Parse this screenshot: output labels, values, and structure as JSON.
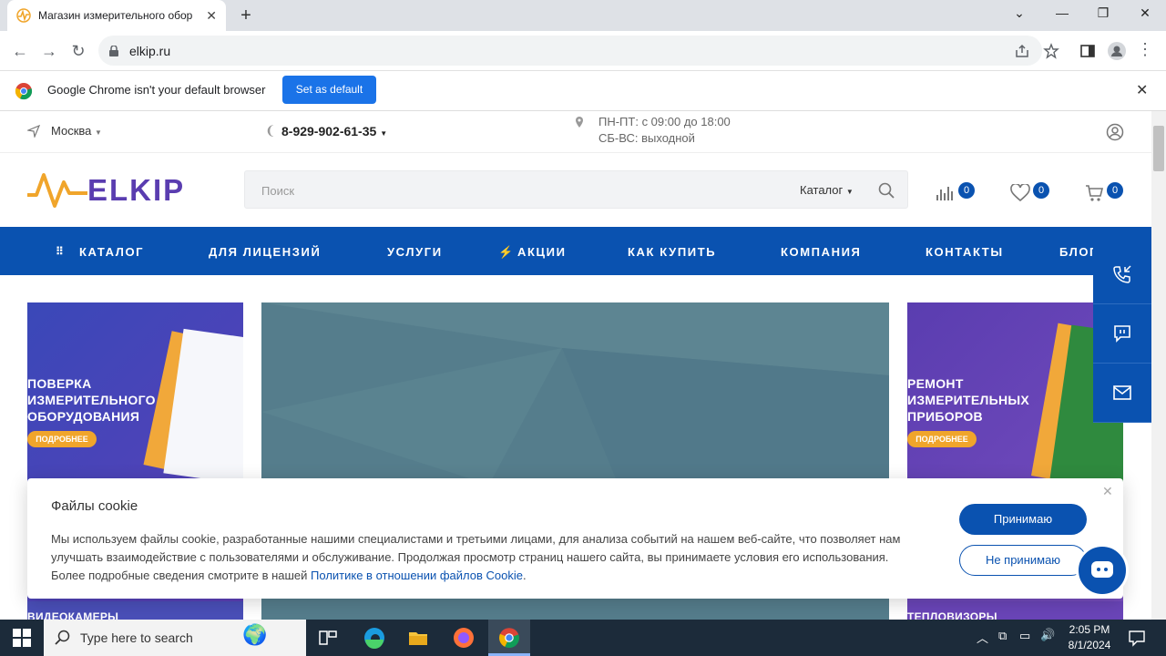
{
  "browser": {
    "tab_title": "Магазин измерительного обор",
    "url": "elkip.ru",
    "infobar_message": "Google Chrome isn't your default browser",
    "infobar_button": "Set as default"
  },
  "header": {
    "city": "Москва",
    "phone": "8-929-902-61-35",
    "hours_weekdays": "ПН-ПТ: с 09:00 до 18:00",
    "hours_weekend": "СБ-ВС: выходной",
    "logo_text": "ELKIP",
    "search_placeholder": "Поиск",
    "search_catalog": "Каталог",
    "compare_count": "0",
    "favorites_count": "0",
    "cart_count": "0"
  },
  "nav": {
    "items": [
      "КАТАЛОГ",
      "ДЛЯ ЛИЦЕНЗИЙ",
      "УСЛУГИ",
      "АКЦИИ",
      "КАК КУПИТЬ",
      "КОМПАНИЯ",
      "КОНТАКТЫ",
      "БЛОГ"
    ]
  },
  "banners": {
    "left_line1": "ПОВЕРКА",
    "left_line2": "ИЗМЕРИТЕЛЬНОГО",
    "left_line3": "ОБОРУДОВАНИЯ",
    "left_button": "ПОДРОБНЕЕ",
    "right_line1": "РЕМОНТ",
    "right_line2": "ИЗМЕРИТЕЛЬНЫХ",
    "right_line3": "ПРИБОРОВ",
    "right_button": "ПОДРОБНЕЕ",
    "bottom_left": "ВИДЕОКАМЕРЫ",
    "bottom_right": "ТЕПЛОВИЗОРЫ"
  },
  "cookie": {
    "title": "Файлы cookie",
    "text": "Мы используем файлы cookie, разработанные нашими специалистами и третьими лицами, для анализа событий на нашем веб-сайте, что позволяет нам улучшать взаимодействие с пользователями и обслуживание. Продолжая просмотр страниц нашего сайта, вы принимаете условия его использования. Более подробные сведения смотрите в нашей ",
    "link": "Политике в отношении файлов Cookie",
    "tail": ".",
    "accept": "Принимаю",
    "decline": "Не принимаю"
  },
  "taskbar": {
    "search_placeholder": "Type here to search",
    "time": "2:05 PM",
    "date": "8/1/2024"
  },
  "colors": {
    "brand_blue": "#0a52b0",
    "accent_orange": "#f0a52b",
    "banner_teal": "#557d8c",
    "banner_purple": "#5a3db0"
  }
}
